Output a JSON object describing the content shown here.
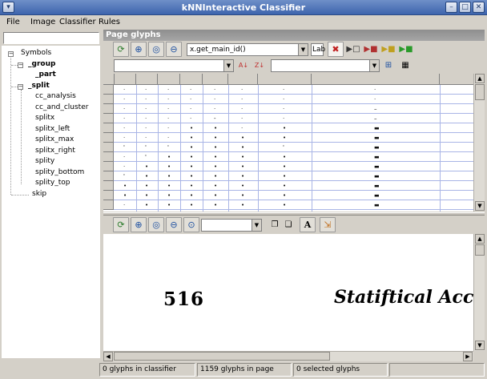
{
  "window": {
    "title": "kNNInteractive Classifier",
    "buttons": [
      "▾",
      "–",
      "□",
      "✕"
    ]
  },
  "menu": {
    "items": [
      "File",
      "Image",
      "Classifier",
      "Rules"
    ]
  },
  "sidebar": {
    "search_value": "",
    "tree": {
      "root": "Symbols",
      "group": "_group",
      "part": "_part",
      "split": "_split",
      "split_children": [
        "cc_analysis",
        "cc_and_cluster",
        "splitx",
        "splitx_left",
        "splitx_max",
        "splitx_right",
        "splity",
        "splity_bottom",
        "splity_top"
      ],
      "skip": "skip"
    }
  },
  "page_glyphs": {
    "title": "Page glyphs",
    "sort_combo_value": "x.get_main_id()",
    "lab_button": "Lab",
    "filter_combo_value": "",
    "filter_combo2_value": "",
    "toolbar_icons": [
      "refresh-icon",
      "zoom-in-icon",
      "zoom-normal-icon",
      "zoom-out-icon"
    ],
    "glyph_rows": [
      [
        "·",
        "·",
        "·",
        "·",
        "·",
        "·",
        "·",
        "·"
      ],
      [
        "·",
        "·",
        "·",
        "·",
        "·",
        "·",
        "·",
        "·"
      ],
      [
        "·",
        "·",
        "·",
        "·",
        "·",
        "·",
        "·",
        "–"
      ],
      [
        "·",
        "·",
        "·",
        "·",
        "-",
        "·",
        "·",
        "–"
      ],
      [
        "·",
        "·",
        "·",
        "•",
        "•",
        "·",
        "•",
        "▬"
      ],
      [
        "·",
        "·",
        "·",
        "•",
        "•",
        "•",
        "•",
        "▬"
      ],
      [
        "'",
        "'",
        "'",
        "•",
        "•",
        "•",
        "'",
        "▬"
      ],
      [
        "·",
        "'",
        "•",
        "•",
        "•",
        "•",
        "•",
        "▬"
      ],
      [
        "·",
        "•",
        "•",
        "•",
        "•",
        "•",
        "•",
        "▬"
      ],
      [
        "'",
        "•",
        "•",
        "•",
        "•",
        "•",
        "•",
        "▬"
      ],
      [
        "•",
        "•",
        "•",
        "•",
        "•",
        "•",
        "•",
        "▬"
      ],
      [
        "•",
        "•",
        "•",
        "•",
        "•",
        "•",
        "•",
        "▬"
      ],
      [
        "·",
        "•",
        "•",
        "•",
        "•",
        "•",
        "•",
        "▬"
      ]
    ]
  },
  "page_view": {
    "zoom_combo_value": "",
    "page_number": "516",
    "heading": "Statiftical Acc"
  },
  "status": {
    "classifier_glyphs": "0 glyphs in classifier",
    "page_glyphs": "1159 glyphs in page",
    "selected_glyphs": "0 selected glyphs"
  },
  "colors": {
    "grid_lines": "#a9b5e6",
    "title_bar": "#3d64ad",
    "panel_title": "#9a9a9a"
  }
}
